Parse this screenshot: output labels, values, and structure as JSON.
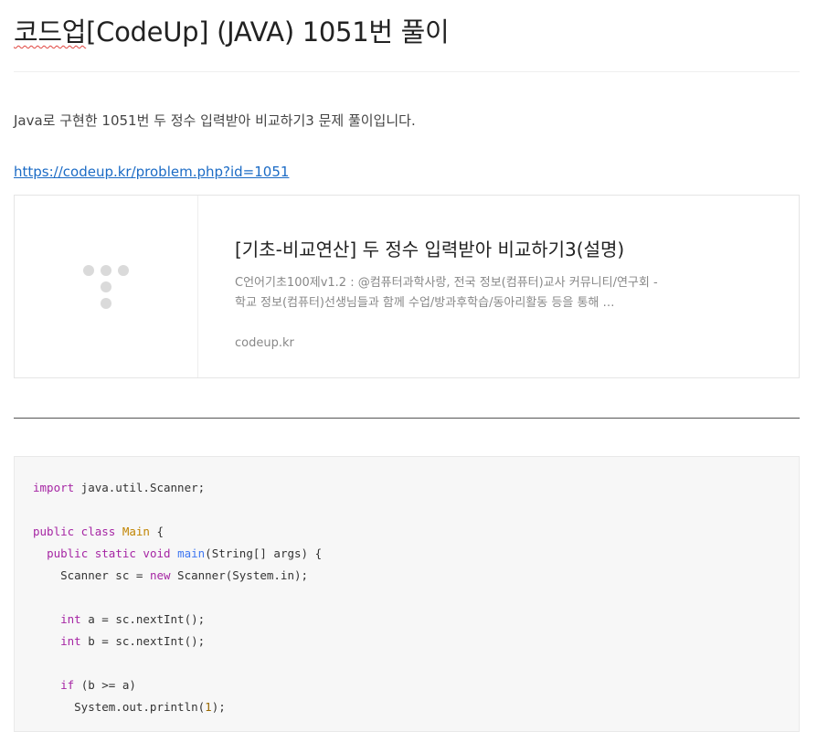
{
  "post": {
    "title_prefix": "코드업",
    "title_rest": "[CodeUp] (JAVA) 1051번 풀이",
    "intro": "Java로 구현한 1051번 두 정수 입력받아 비교하기3 문제 풀이입니다.",
    "link": "https://codeup.kr/problem.php?id=1051"
  },
  "og_card": {
    "title": "[기초-비교연산] 두 정수 입력받아 비교하기3(설명)",
    "description": "C언어기초100제v1.2 : @컴퓨터과학사랑, 전국 정보(컴퓨터)교사 커뮤니티/연구회 - 학교 정보(컴퓨터)선생님들과 함께 수업/방과후학습/동아리활동 등을 통해 …",
    "host": "codeup.kr",
    "thumbnail_icon": "codeup-logo-icon"
  },
  "code": {
    "l1_kw": "import",
    "l1_rest": " java.util.Scanner;",
    "l3_kw": "public class",
    "l3_cls": "Main",
    "l3_rest": " {",
    "l4_indent": "  ",
    "l4_kw": "public static void",
    "l4_fn": "main",
    "l4_rest": "(String[] args) {",
    "l5_a": "    Scanner sc = ",
    "l5_kw": "new",
    "l5_b": " Scanner(System.in);",
    "l7_indent": "    ",
    "l7_kw": "int",
    "l7_rest": " a = sc.nextInt();",
    "l8_indent": "    ",
    "l8_kw": "int",
    "l8_rest": " b = sc.nextInt();",
    "l10_indent": "    ",
    "l10_kw": "if",
    "l10_rest": " (b >= a)",
    "l11_a": "      System.out.println(",
    "l11_num": "1",
    "l11_b": ");"
  },
  "colors": {
    "link": "#1b6bc5",
    "keyword": "#a626a4",
    "class_name": "#c18401",
    "function": "#4078f2",
    "number": "#986801",
    "code_background": "#f7f7f7"
  }
}
